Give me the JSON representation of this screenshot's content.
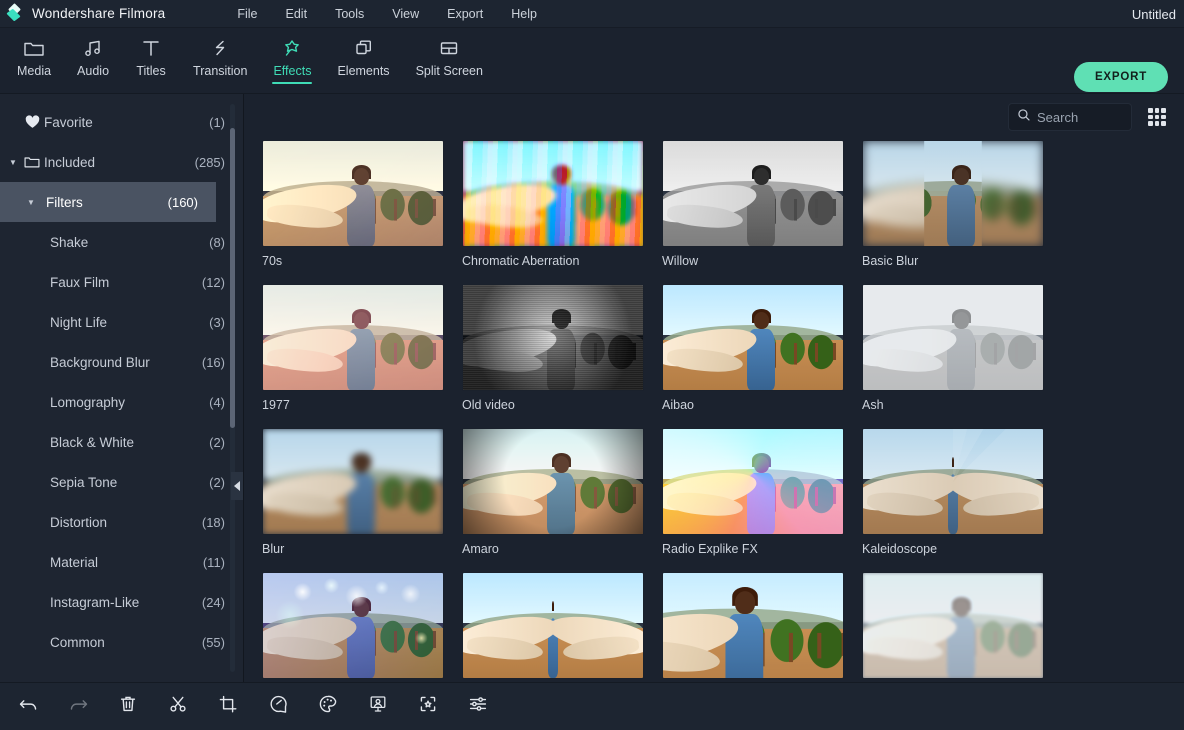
{
  "app": {
    "brand": "Wondershare Filmora",
    "document_title": "Untitled",
    "logo_icon": "filmora-logo-icon",
    "accent_color": "#3fdcb6",
    "export_accent_color": "#5fe0b4",
    "background_color": "#1b222e",
    "sidebar_color": "#1e2531",
    "titlebar_color": "#1d2531",
    "selected_row_color": "#4a5362"
  },
  "menubar": {
    "items": [
      {
        "label": "File"
      },
      {
        "label": "Edit"
      },
      {
        "label": "Tools"
      },
      {
        "label": "View"
      },
      {
        "label": "Export"
      },
      {
        "label": "Help"
      }
    ]
  },
  "toolbar": {
    "tabs": [
      {
        "label": "Media",
        "icon": "folder-icon",
        "active": false
      },
      {
        "label": "Audio",
        "icon": "music-note-icon",
        "active": false
      },
      {
        "label": "Titles",
        "icon": "text-t-icon",
        "active": false
      },
      {
        "label": "Transition",
        "icon": "transition-icon",
        "active": false
      },
      {
        "label": "Effects",
        "icon": "magic-star-icon",
        "active": true
      },
      {
        "label": "Elements",
        "icon": "layers-icon",
        "active": false
      },
      {
        "label": "Split Screen",
        "icon": "split-screen-icon",
        "active": false
      }
    ],
    "export_label": "EXPORT"
  },
  "sidebar": {
    "collapse_handle_icon": "chevron-left-icon",
    "items": [
      {
        "label": "Favorite",
        "count": "(1)",
        "level": 0,
        "icon": "heart-icon",
        "caret": "",
        "selected": false
      },
      {
        "label": "Included",
        "count": "(285)",
        "level": 0,
        "icon": "folder-icon",
        "caret": "▼",
        "selected": false
      },
      {
        "label": "Filters",
        "count": "(160)",
        "level": 1,
        "icon": "",
        "caret": "▼",
        "selected": true
      },
      {
        "label": "Shake",
        "count": "(8)",
        "level": 2,
        "icon": "",
        "caret": "",
        "selected": false
      },
      {
        "label": "Faux Film",
        "count": "(12)",
        "level": 2,
        "icon": "",
        "caret": "",
        "selected": false
      },
      {
        "label": "Night Life",
        "count": "(3)",
        "level": 2,
        "icon": "",
        "caret": "",
        "selected": false
      },
      {
        "label": "Background Blur",
        "count": "(16)",
        "level": 2,
        "icon": "",
        "caret": "",
        "selected": false
      },
      {
        "label": "Lomography",
        "count": "(4)",
        "level": 2,
        "icon": "",
        "caret": "",
        "selected": false
      },
      {
        "label": "Black & White",
        "count": "(2)",
        "level": 2,
        "icon": "",
        "caret": "",
        "selected": false
      },
      {
        "label": "Sepia Tone",
        "count": "(2)",
        "level": 2,
        "icon": "",
        "caret": "",
        "selected": false
      },
      {
        "label": "Distortion",
        "count": "(18)",
        "level": 2,
        "icon": "",
        "caret": "",
        "selected": false
      },
      {
        "label": "Material",
        "count": "(11)",
        "level": 2,
        "icon": "",
        "caret": "",
        "selected": false
      },
      {
        "label": "Instagram-Like",
        "count": "(24)",
        "level": 2,
        "icon": "",
        "caret": "",
        "selected": false
      },
      {
        "label": "Common",
        "count": "(55)",
        "level": 2,
        "icon": "",
        "caret": "",
        "selected": false
      }
    ]
  },
  "content": {
    "search": {
      "placeholder": "Search",
      "value": "",
      "icon": "search-icon"
    },
    "grid_toggle_icon": "grid-dots-icon",
    "effects": [
      {
        "label": "70s",
        "style": "f-70s",
        "overlay": "warm"
      },
      {
        "label": "Chromatic Aberration",
        "style": "f-chrom",
        "overlay": "chromstripes"
      },
      {
        "label": "Willow",
        "style": "f-bw",
        "overlay": "none"
      },
      {
        "label": "Basic Blur",
        "style": "f-blurb",
        "overlay": "none"
      },
      {
        "label": "1977",
        "style": "f-1977",
        "overlay": "warm"
      },
      {
        "label": "Old video",
        "style": "f-old",
        "overlay": "grain"
      },
      {
        "label": "Aibao",
        "style": "f-aibao",
        "overlay": "none"
      },
      {
        "label": "Ash",
        "style": "f-ash",
        "overlay": "white"
      },
      {
        "label": "Blur",
        "style": "f-blur",
        "overlay": "none"
      },
      {
        "label": "Amaro",
        "style": "f-amaro",
        "overlay": "vignette"
      },
      {
        "label": "Radio Explike FX",
        "style": "f-radio",
        "overlay": "rainbow"
      },
      {
        "label": "Kaleidoscope",
        "style": "f-kal",
        "overlay": "kal"
      },
      {
        "label": "",
        "style": "f-night",
        "overlay": "bokeh"
      },
      {
        "label": "",
        "style": "f-aibao",
        "overlay": "mirror"
      },
      {
        "label": "",
        "style": "f-aibao",
        "overlay": "mirror2"
      },
      {
        "label": "",
        "style": "f-soft",
        "overlay": "white"
      }
    ]
  },
  "bottom_toolbar": {
    "buttons": [
      {
        "name": "undo-button",
        "icon": "undo-arrow-icon",
        "disabled": false
      },
      {
        "name": "redo-button",
        "icon": "redo-arrow-icon",
        "disabled": true
      },
      {
        "name": "delete-button",
        "icon": "trash-icon",
        "disabled": false
      },
      {
        "name": "split-button",
        "icon": "scissors-icon",
        "disabled": false
      },
      {
        "name": "crop-button",
        "icon": "crop-icon",
        "disabled": false
      },
      {
        "name": "speed-button",
        "icon": "speedometer-icon",
        "disabled": false
      },
      {
        "name": "color-button",
        "icon": "palette-icon",
        "disabled": false
      },
      {
        "name": "green-screen-button",
        "icon": "green-screen-icon",
        "disabled": false
      },
      {
        "name": "auto-enhance-button",
        "icon": "auto-enhance-icon",
        "disabled": false
      },
      {
        "name": "settings-button",
        "icon": "sliders-icon",
        "disabled": false
      }
    ]
  }
}
